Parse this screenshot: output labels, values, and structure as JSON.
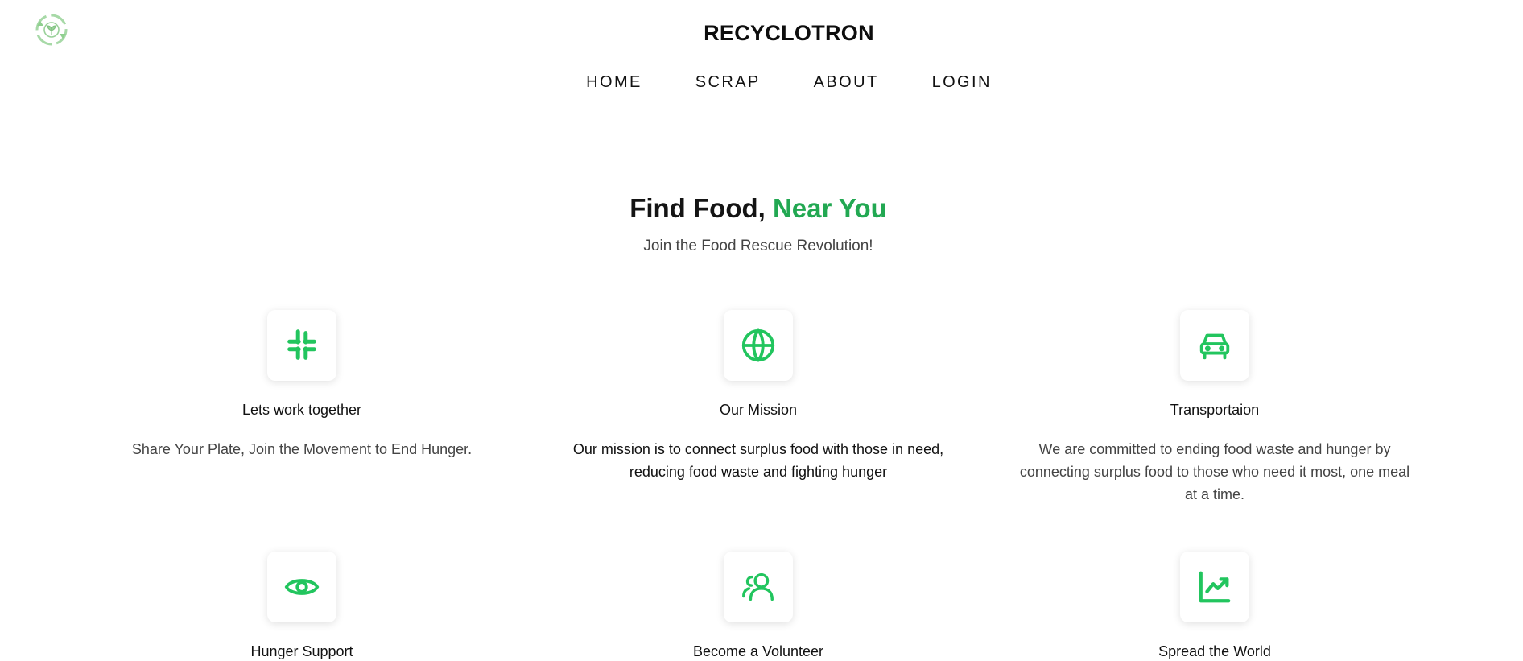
{
  "header": {
    "brand": "RECYCLOTRON",
    "nav": [
      "HOME",
      "SCRAP",
      "ABOUT",
      "LOGIN"
    ]
  },
  "hero": {
    "title_main": "Find Food,",
    "title_accent": "Near You",
    "subtitle": "Join the Food Rescue Revolution!"
  },
  "features": [
    {
      "icon": "slack-icon",
      "title": "Lets work together",
      "text": "Share Your Plate, Join the Movement to End Hunger."
    },
    {
      "icon": "globe-icon",
      "title": "Our Mission",
      "text": "Our mission is to connect surplus food with those in need, reducing food waste and fighting hunger"
    },
    {
      "icon": "car-icon",
      "title": "Transportaion",
      "text": "We are committed to ending food waste and hunger by connecting surplus food to those who need it most, one meal at a time."
    },
    {
      "icon": "eye-icon",
      "title": "Hunger Support",
      "text": ""
    },
    {
      "icon": "users-icon",
      "title": "Become a Volunteer",
      "text": ""
    },
    {
      "icon": "chart-line-icon",
      "title": "Spread the World",
      "text": ""
    }
  ],
  "colors": {
    "accent": "#22a852",
    "icon": "#22c55e"
  }
}
